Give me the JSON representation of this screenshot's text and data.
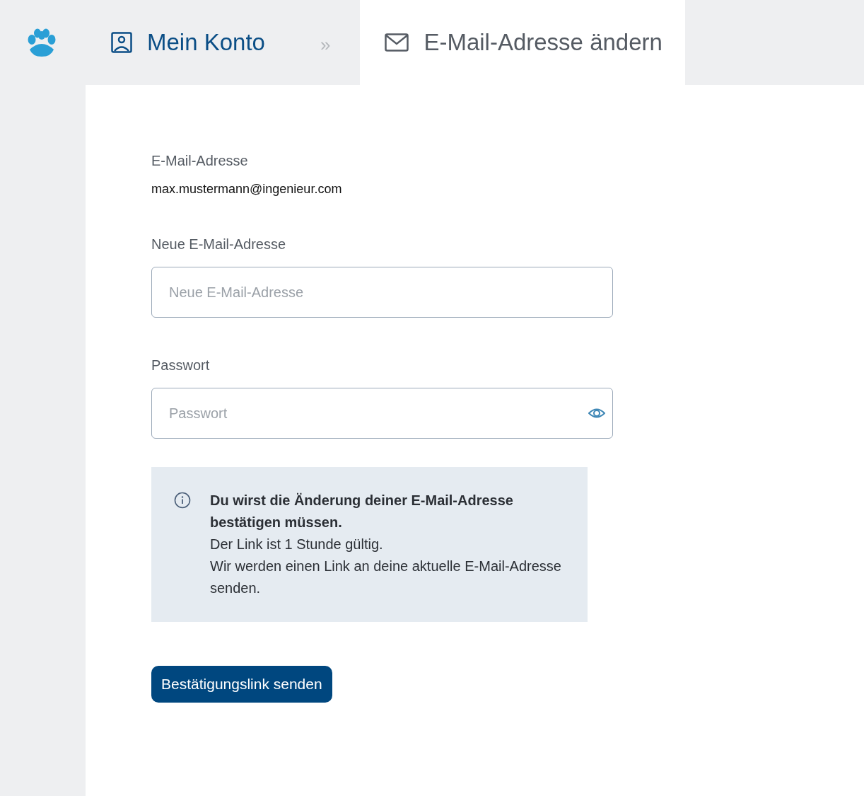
{
  "breadcrumb": {
    "separator": "»",
    "items": [
      {
        "label": "Mein Konto",
        "kind": "account",
        "selected": false
      },
      {
        "label": "E-Mail-Adresse ändern",
        "kind": "email",
        "selected": true
      }
    ]
  },
  "current_email": {
    "label": "E-Mail-Adresse",
    "value": "max.mustermann@ingenieur.com"
  },
  "fields": [
    {
      "label": "Neue E-Mail-Adresse",
      "placeholder": "Neue E-Mail-Adresse",
      "kind": "email"
    },
    {
      "label": "Passwort",
      "placeholder": "Passwort",
      "kind": "password"
    }
  ],
  "info": {
    "title": "Du wirst die Änderung deiner E-Mail-Adresse bestätigen müssen.",
    "lines": [
      "Der Link ist 1 Stunde gültig.",
      "Wir werden einen Link an deine aktuelle E-Mail-Adresse senden."
    ]
  },
  "button": {
    "label": "Bestätigungslink senden"
  }
}
